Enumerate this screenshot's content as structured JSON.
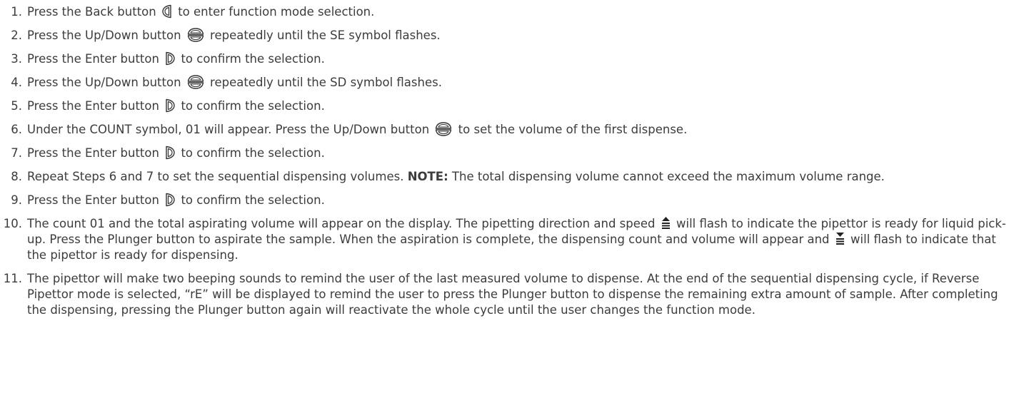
{
  "steps": [
    {
      "number": "1.",
      "parts": [
        {
          "t": "text",
          "v": "Press the Back button "
        },
        {
          "t": "icon",
          "v": "back-button-icon"
        },
        {
          "t": "text",
          "v": " to enter function mode selection."
        }
      ]
    },
    {
      "number": "2.",
      "parts": [
        {
          "t": "text",
          "v": "Press the Up/Down button "
        },
        {
          "t": "icon",
          "v": "up-down-button-icon"
        },
        {
          "t": "text",
          "v": " repeatedly until the SE symbol flashes."
        }
      ]
    },
    {
      "number": "3.",
      "parts": [
        {
          "t": "text",
          "v": "Press the Enter button "
        },
        {
          "t": "icon",
          "v": "enter-button-icon"
        },
        {
          "t": "text",
          "v": " to confirm the selection."
        }
      ]
    },
    {
      "number": "4.",
      "parts": [
        {
          "t": "text",
          "v": "Press the Up/Down button "
        },
        {
          "t": "icon",
          "v": "up-down-button-icon"
        },
        {
          "t": "text",
          "v": " repeatedly until the SD symbol flashes."
        }
      ]
    },
    {
      "number": "5.",
      "parts": [
        {
          "t": "text",
          "v": "Press the Enter button "
        },
        {
          "t": "icon",
          "v": "enter-button-icon"
        },
        {
          "t": "text",
          "v": " to confirm the selection."
        }
      ]
    },
    {
      "number": "6.",
      "parts": [
        {
          "t": "text",
          "v": "Under the COUNT symbol, 01 will appear. Press the Up/Down button "
        },
        {
          "t": "icon",
          "v": "up-down-button-icon"
        },
        {
          "t": "text",
          "v": " to set the volume of the first dispense."
        }
      ]
    },
    {
      "number": "7.",
      "parts": [
        {
          "t": "text",
          "v": "Press the Enter button "
        },
        {
          "t": "icon",
          "v": "enter-button-icon"
        },
        {
          "t": "text",
          "v": " to confirm the selection."
        }
      ]
    },
    {
      "number": "8.",
      "parts": [
        {
          "t": "text",
          "v": "Repeat Steps 6 and 7 to set the sequential dispensing volumes. "
        },
        {
          "t": "bold",
          "v": "NOTE:"
        },
        {
          "t": "text",
          "v": " The total dispensing volume cannot exceed the maximum volume range."
        }
      ]
    },
    {
      "number": "9.",
      "parts": [
        {
          "t": "text",
          "v": "Press the Enter button "
        },
        {
          "t": "icon",
          "v": "enter-button-icon"
        },
        {
          "t": "text",
          "v": " to confirm the selection."
        }
      ]
    },
    {
      "number": "10.",
      "parts": [
        {
          "t": "text",
          "v": "The count 01 and the total aspirating volume will appear on the display. The pipetting direction and speed "
        },
        {
          "t": "icon",
          "v": "aspirate-speed-icon"
        },
        {
          "t": "text",
          "v": " will flash to indicate the pipettor is ready for liquid pick-up. Press the Plunger button to aspirate the sample. When the aspiration is complete, the dispensing count and volume will appear and "
        },
        {
          "t": "icon",
          "v": "dispense-speed-icon"
        },
        {
          "t": "text",
          "v": " will flash to indicate that the pipettor is ready for dispensing."
        }
      ]
    },
    {
      "number": "11.",
      "parts": [
        {
          "t": "text",
          "v": "The pipettor will make two beeping sounds to remind the user of the last measured volume to dispense. At the end of the sequential dispensing cycle, if Reverse Pipettor mode is selected, “rE” will be displayed to remind the user to press the Plunger button to dispense the remaining extra amount of sample. After completing the dispensing, pressing the Plunger button again will reactivate the whole cycle until the user changes the function mode."
        }
      ]
    }
  ]
}
